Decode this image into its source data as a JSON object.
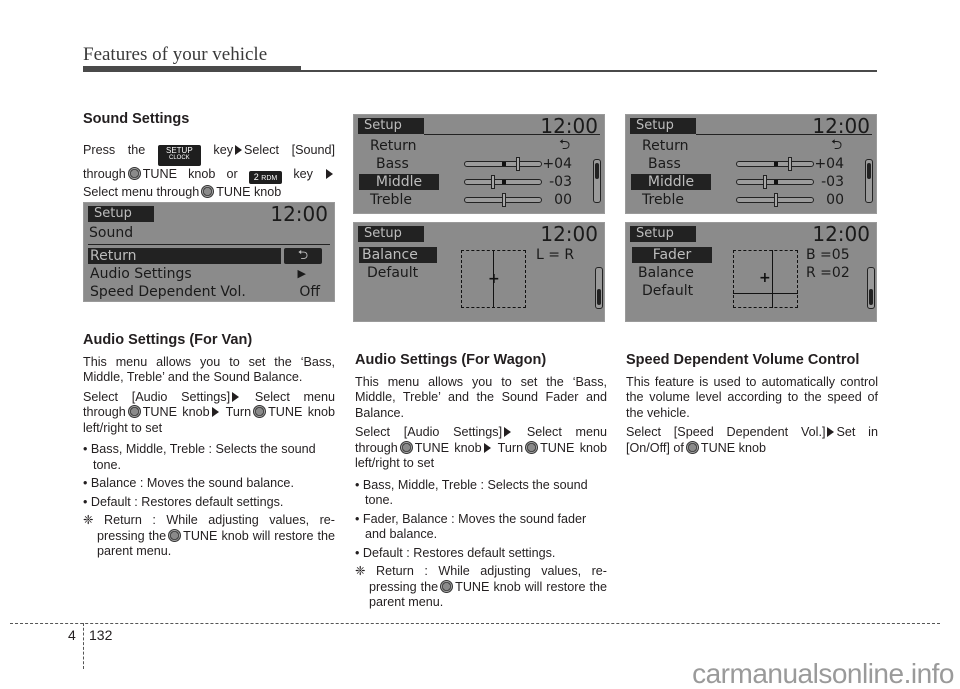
{
  "header": {
    "title": "Features of your vehicle"
  },
  "sound_settings": {
    "heading": "Sound Settings",
    "press_the": "Press the",
    "setup_key_top": "SETUP",
    "setup_key_bottom": "CLOCK",
    "key_select": "key",
    "select_sound": "Select [Sound]",
    "through": "through",
    "tune_knob_or": "TUNE knob or",
    "rdm_key_num": "2",
    "rdm_key_label": "RDM",
    "key_word": "key",
    "select_menu_through": "Select menu through",
    "tune_knob": "TUNE knob"
  },
  "screens": {
    "sound": {
      "title": "Setup",
      "clock": "12:00",
      "subtitle": "Sound",
      "rows": [
        {
          "label": "Return",
          "value": "return-arrow",
          "selected": true
        },
        {
          "label": "Audio Settings",
          "value": "▶"
        },
        {
          "label": "Speed Dependent Vol.",
          "value": "Off"
        }
      ]
    },
    "tone_van": {
      "title": "Setup",
      "clock": "12:00",
      "rows": [
        {
          "label": "Return",
          "value": "return-arrow"
        },
        {
          "label": "Bass",
          "value": "+04",
          "level": 4
        },
        {
          "label": "Middle",
          "value": "-03",
          "level": -3,
          "selected": true
        },
        {
          "label": "Treble",
          "value": "00",
          "level": 0
        }
      ],
      "scroll_position": "top"
    },
    "tone_wagon": {
      "title": "Setup",
      "clock": "12:00",
      "rows": [
        {
          "label": "Return",
          "value": "return-arrow"
        },
        {
          "label": "Bass",
          "value": "+04",
          "level": 4
        },
        {
          "label": "Middle",
          "value": "-03",
          "level": -3,
          "selected": true
        },
        {
          "label": "Treble",
          "value": "00",
          "level": 0
        }
      ],
      "scroll_position": "top"
    },
    "balance_van": {
      "title": "Setup",
      "clock": "12:00",
      "rows": [
        {
          "label": "Balance",
          "selected": true
        },
        {
          "label": "Default"
        }
      ],
      "readout": "L = R",
      "scroll_position": "bottom"
    },
    "fader_wagon": {
      "title": "Setup",
      "clock": "12:00",
      "rows": [
        {
          "label": "Fader",
          "selected": true
        },
        {
          "label": "Balance"
        },
        {
          "label": "Default"
        }
      ],
      "readout_fader": "B =05",
      "readout_balance": "R =02",
      "scroll_position": "bottom"
    }
  },
  "van": {
    "heading": "Audio Settings (For Van)",
    "intro": "This menu allows you to set the ‘Bass, Middle, Treble’ and the Sound Balance.",
    "select_audio": "Select [Audio Settings]",
    "select_menu": "Select menu",
    "through": "through",
    "tune_knob": "TUNE knob",
    "turn": "Turn",
    "tune": "TUNE",
    "knob_left_right": "knob left/right to set",
    "bullets": [
      "• Bass, Middle, Treble : Selects the sound tone.",
      "• Balance : Moves the sound balance.",
      "• Default : Restores default settings."
    ],
    "note_prefix": "❈ Return : While adjusting values, re-pressing the",
    "note_suffix": "TUNE knob will restore the parent menu."
  },
  "wagon": {
    "heading": "Audio Settings (For Wagon)",
    "intro": "This menu allows you to set the ‘Bass, Middle, Treble’ and the Sound Fader and Balance.",
    "select_audio": "Select [Audio Settings]",
    "select_menu": "Select menu",
    "through": "through",
    "tune_knob": "TUNE knob",
    "turn": "Turn",
    "tune": "TUNE",
    "knob_left_right": "knob left/right to set",
    "bullets": [
      "• Bass, Middle, Treble : Selects the sound tone.",
      "• Fader, Balance : Moves the sound fader and balance.",
      "• Default : Restores default settings."
    ],
    "note_prefix": "❈ Return : While adjusting values, re-pressing the",
    "note_suffix": "TUNE knob will restore the parent menu."
  },
  "speed_dependent": {
    "heading": "Speed Dependent Volume Control",
    "intro": "This feature is used to automatically control the volume level according to the speed of the vehicle.",
    "select": "Select [Speed Dependent Vol.]",
    "set_in": "Set in [On/Off] of",
    "tune_knob": "TUNE knob"
  },
  "footer": {
    "chapter": "4",
    "page": "132",
    "watermark": "carmanualsonline.info"
  }
}
